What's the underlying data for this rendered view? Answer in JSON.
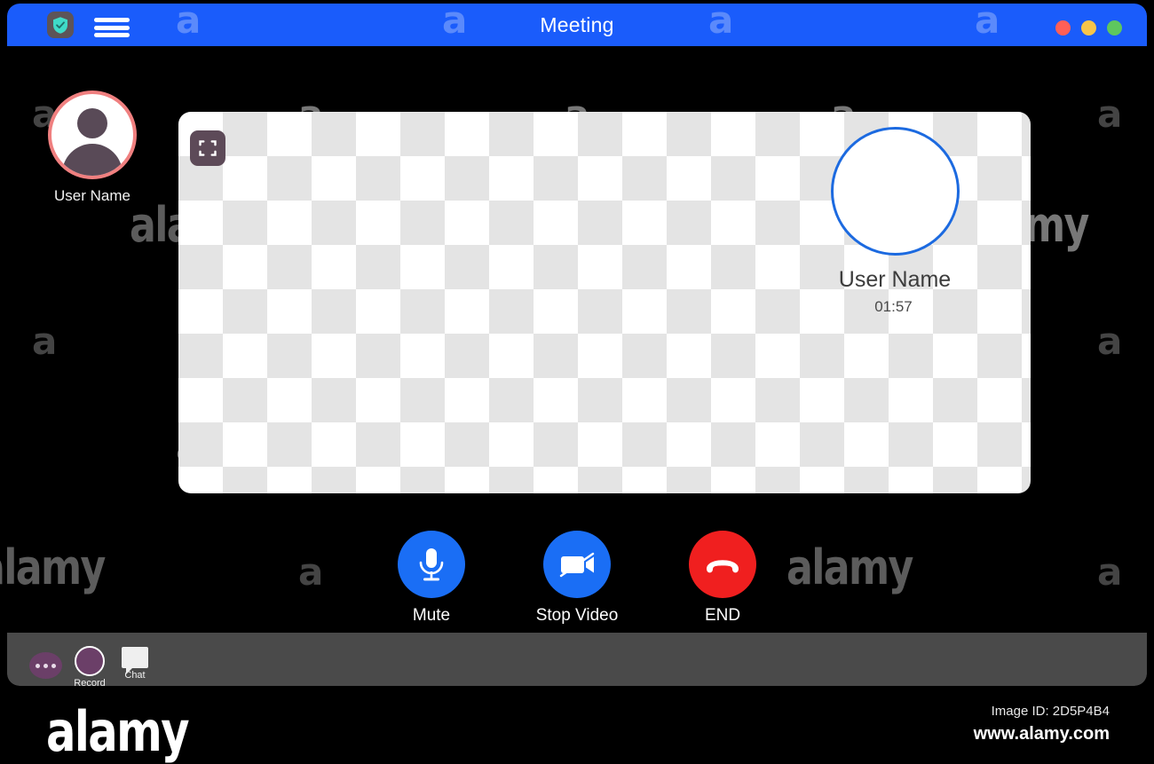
{
  "window": {
    "title": "Meeting",
    "menu_icon": "hamburger-menu-icon",
    "shield_icon": "shield-check-icon",
    "traffic_lights": [
      {
        "name": "close",
        "color": "#ff5f57"
      },
      {
        "name": "minimize",
        "color": "#f7c54a"
      },
      {
        "name": "maximize",
        "color": "#5ec75e"
      }
    ]
  },
  "self_participant": {
    "name": "User Name",
    "avatar_icon": "person-avatar-icon",
    "ring_color": "#f08080"
  },
  "video_panel": {
    "fullscreen_icon": "fullscreen-expand-icon",
    "remote": {
      "name": "User Name",
      "timer": "01:57",
      "ring_color": "#1c6ae0"
    }
  },
  "call_controls": [
    {
      "label": "Mute",
      "icon": "microphone-icon",
      "color": "#1a6ef5",
      "name": "mute"
    },
    {
      "label": "Stop Video",
      "icon": "camera-slash-icon",
      "color": "#1a6ef5",
      "name": "stop-video"
    },
    {
      "label": "END",
      "icon": "phone-hangup-icon",
      "color": "#f01f1f",
      "name": "end-call"
    }
  ],
  "toolbar": {
    "more_label": "",
    "more_icon": "more-dots-icon",
    "record_label": "Record",
    "record_icon": "record-circle-icon",
    "chat_label": "Chat",
    "chat_icon": "chat-bubble-icon"
  },
  "footer": {
    "logo": "alamy",
    "image_id": "Image ID: 2D5P4B4",
    "url": "www.alamy.com"
  },
  "watermarks": {
    "word": "alamy",
    "letter": "a"
  }
}
